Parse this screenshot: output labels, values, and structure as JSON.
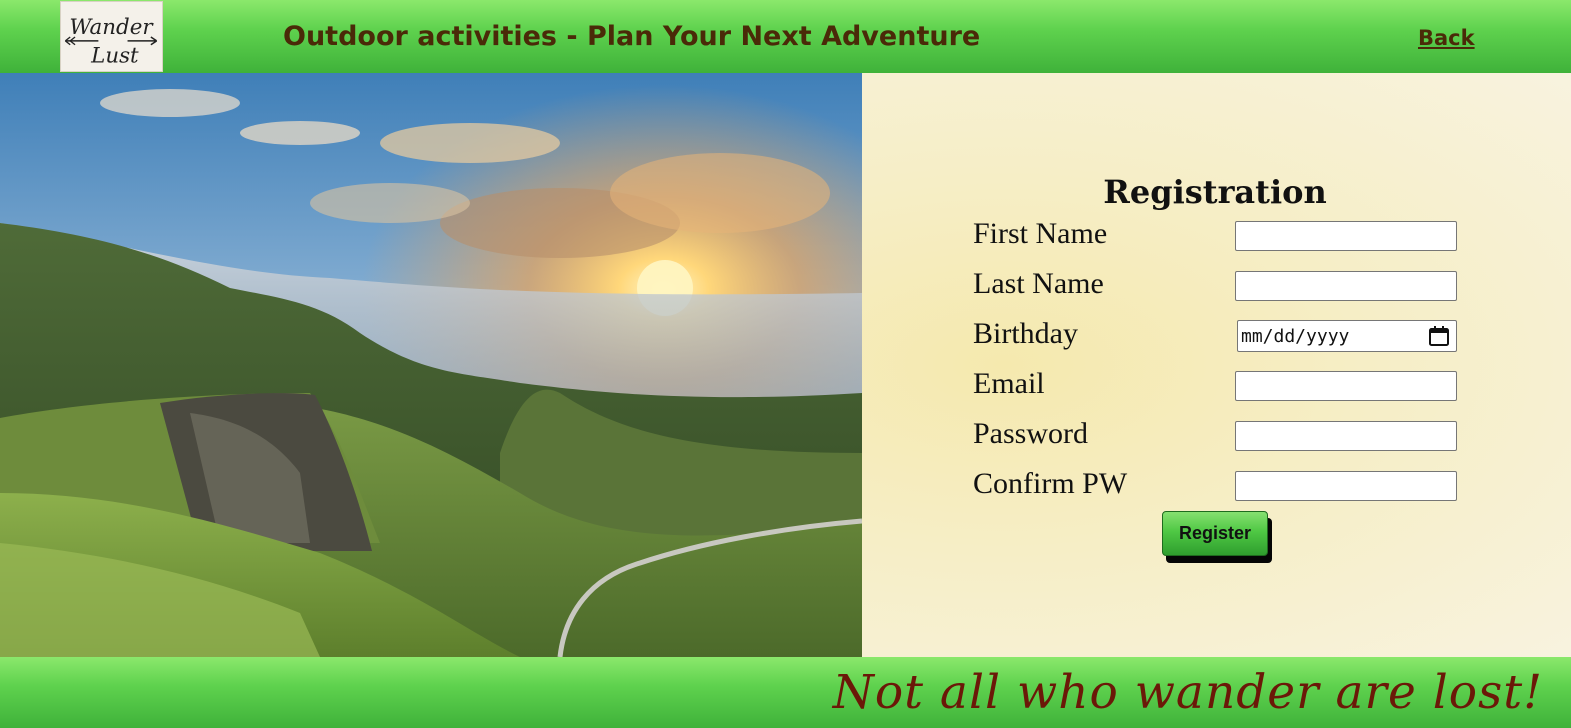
{
  "header": {
    "logo_text": "Wander Lust",
    "title": "Outdoor activities - Plan Your Next Adventure",
    "back_label": "Back"
  },
  "registration": {
    "title": "Registration",
    "fields": [
      {
        "label": "First Name",
        "value": "",
        "type": "text"
      },
      {
        "label": "Last Name",
        "value": "",
        "type": "text"
      },
      {
        "label": "Birthday",
        "value": "mm/dd/yyyy",
        "type": "date"
      },
      {
        "label": "Email",
        "value": "",
        "type": "text"
      },
      {
        "label": "Password",
        "value": "",
        "type": "password"
      },
      {
        "label": "Confirm PW",
        "value": "",
        "type": "password"
      }
    ],
    "submit_label": "Register"
  },
  "footer": {
    "tagline": "Not all who wander are lost!"
  },
  "icons": {
    "calendar": "calendar-icon",
    "logo": "wanderlust-logo"
  },
  "colors": {
    "header_green": "#5fd24e",
    "title_brown": "#4a2a08",
    "tagline_red": "#6b1808",
    "panel_cream": "#f6eec6"
  }
}
